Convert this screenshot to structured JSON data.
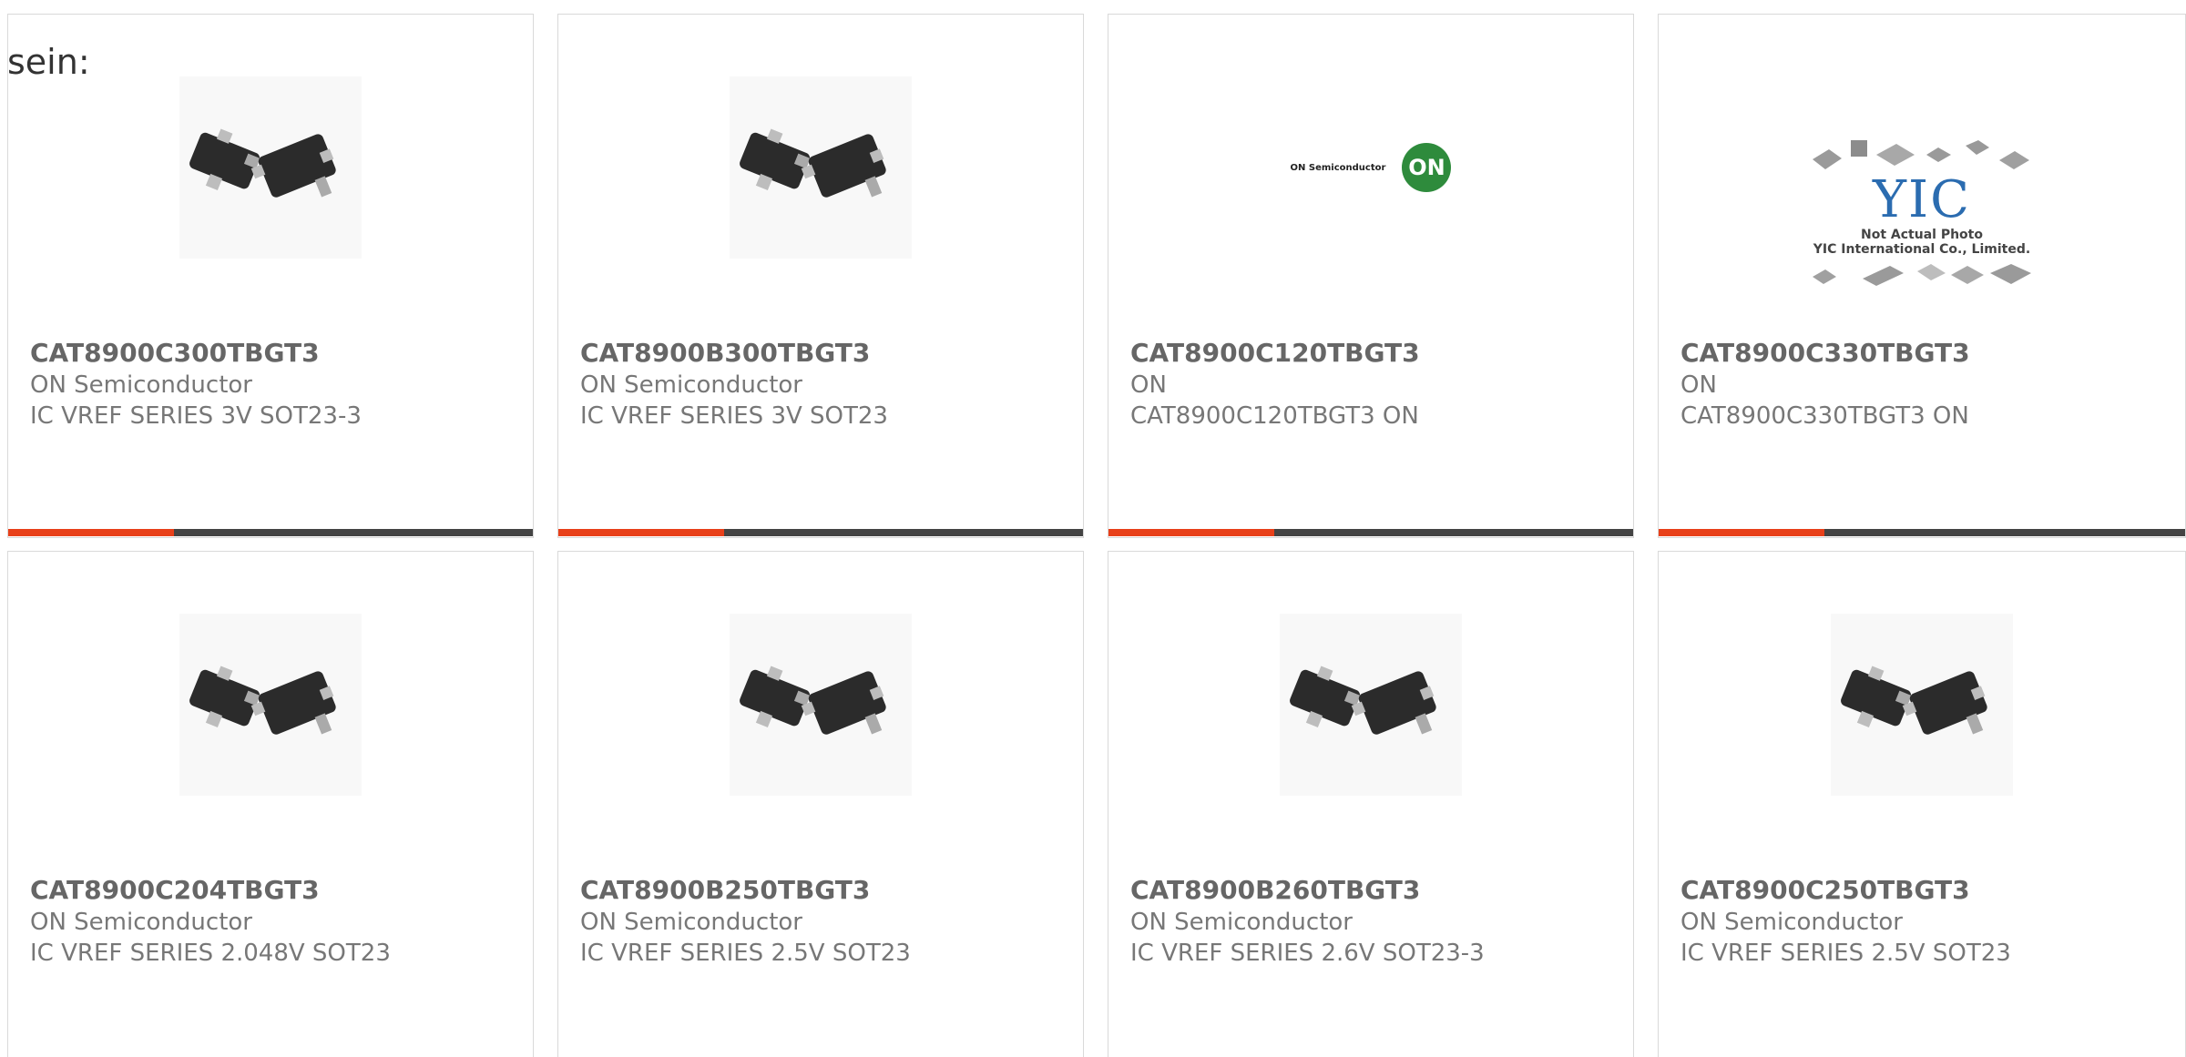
{
  "heading_fragment": "sein:",
  "colors": {
    "accent": "#e8401a",
    "bar": "#444444",
    "border": "#d9d9d9"
  },
  "cards": [
    {
      "part": "CAT8900C300TBGT3",
      "manufacturer": "ON Semiconductor",
      "description": "IC VREF SERIES 3V SOT23-3",
      "image": "sot23-chip-photo"
    },
    {
      "part": "CAT8900B300TBGT3",
      "manufacturer": "ON Semiconductor",
      "description": "IC VREF SERIES 3V SOT23",
      "image": "sot23-chip-photo"
    },
    {
      "part": "CAT8900C120TBGT3",
      "manufacturer": "ON",
      "description": "CAT8900C120TBGT3 ON",
      "image": "on-semiconductor-logo",
      "logo_text": "ON Semiconductor",
      "logo_mark": "ON"
    },
    {
      "part": "CAT8900C330TBGT3",
      "manufacturer": "ON",
      "description": "CAT8900C330TBGT3 ON",
      "image": "yic-placeholder",
      "logo_text": "YIC",
      "caption1": "Not Actual Photo",
      "caption2": "YIC International Co., Limited."
    },
    {
      "part": "CAT8900C204TBGT3",
      "manufacturer": "ON Semiconductor",
      "description": "IC VREF SERIES 2.048V SOT23",
      "image": "sot23-chip-photo"
    },
    {
      "part": "CAT8900B250TBGT3",
      "manufacturer": "ON Semiconductor",
      "description": "IC VREF SERIES 2.5V SOT23",
      "image": "sot23-chip-photo"
    },
    {
      "part": "CAT8900B260TBGT3",
      "manufacturer": "ON Semiconductor",
      "description": "IC VREF SERIES 2.6V SOT23-3",
      "image": "sot23-chip-photo"
    },
    {
      "part": "CAT8900C250TBGT3",
      "manufacturer": "ON Semiconductor",
      "description": "IC VREF SERIES 2.5V SOT23",
      "image": "sot23-chip-photo"
    }
  ]
}
